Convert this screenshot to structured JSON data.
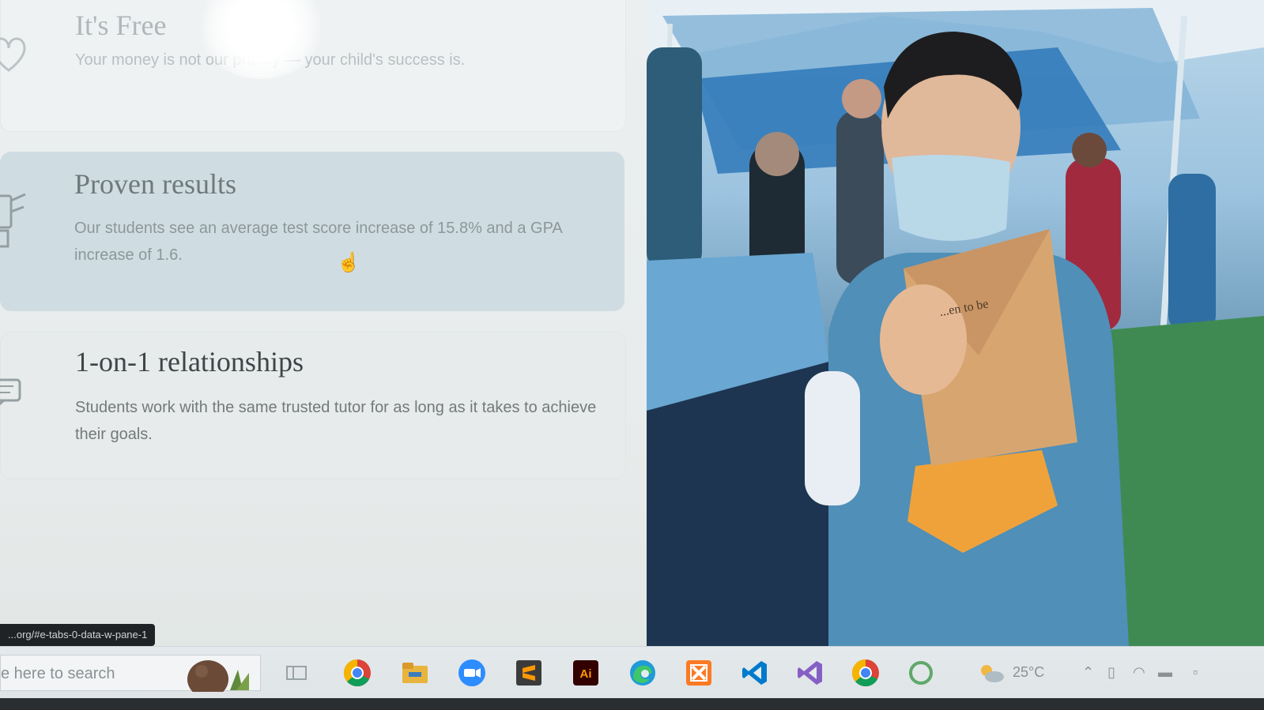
{
  "features": [
    {
      "title": "It's Free",
      "description": "Your money is not our priority — your child's success is.",
      "icon": "heart-icon"
    },
    {
      "title": "Proven results",
      "description": "Our students see an average test score increase of 15.8% and a GPA increase of 1.6.",
      "icon": "trophy-icon"
    },
    {
      "title": "1-on-1 relationships",
      "description": "Students work with the same trusted tutor for as long as it takes to achieve their goals.",
      "icon": "chat-icon"
    }
  ],
  "status_url": "...org/#e-tabs-0-data-w-pane-1",
  "photo": {
    "envelope_text": "...en to be"
  },
  "taskbar": {
    "search_placeholder": "e here to search",
    "apps": [
      "task-view-icon",
      "chrome-icon",
      "file-explorer-icon",
      "zoom-icon",
      "sublime-text-icon",
      "illustrator-icon",
      "edge-icon",
      "xampp-icon",
      "vscode-icon",
      "visual-studio-icon",
      "chrome-profile-icon",
      "circle-app-icon"
    ],
    "weather": "25°C"
  },
  "colors": {
    "proven_card": "#cfdde3",
    "taskbar_bg": "#e4e9ec",
    "status_bar_bg": "#202326"
  }
}
